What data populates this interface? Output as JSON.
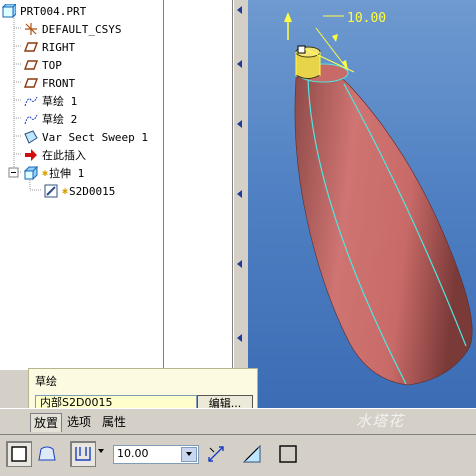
{
  "model_tree": {
    "root": "PRT004.PRT",
    "items": [
      {
        "label": "DEFAULT_CSYS",
        "icon": "csys-icon"
      },
      {
        "label": "RIGHT",
        "icon": "datum-plane-icon"
      },
      {
        "label": "TOP",
        "icon": "datum-plane-icon"
      },
      {
        "label": "FRONT",
        "icon": "datum-plane-icon"
      },
      {
        "label": "草绘 1",
        "icon": "sketch-icon"
      },
      {
        "label": "草绘 2",
        "icon": "sketch-icon"
      },
      {
        "label": "Var Sect Sweep 1",
        "icon": "sweep-icon"
      },
      {
        "label": "在此插入",
        "icon": "insert-here-arrow-icon"
      },
      {
        "label": "拉伸 1",
        "icon": "extrude-icon"
      },
      {
        "label": "S2D0015",
        "icon": "sketch-feature-icon"
      }
    ]
  },
  "viewport": {
    "dimension_value": "10.00"
  },
  "dashboard_panel": {
    "title": "草绘",
    "sketch_field": "内部S2D0015",
    "edit_button": "编辑..."
  },
  "tabs": [
    "放置",
    "选项",
    "属性"
  ],
  "toolbar": {
    "depth_value": "10.00"
  },
  "watermark": "水塔花",
  "colors": {
    "viewport_bg": "#4e7fc2",
    "model": "#c86a68",
    "edge": "#4fe6e0",
    "dimension": "#ffff40"
  }
}
